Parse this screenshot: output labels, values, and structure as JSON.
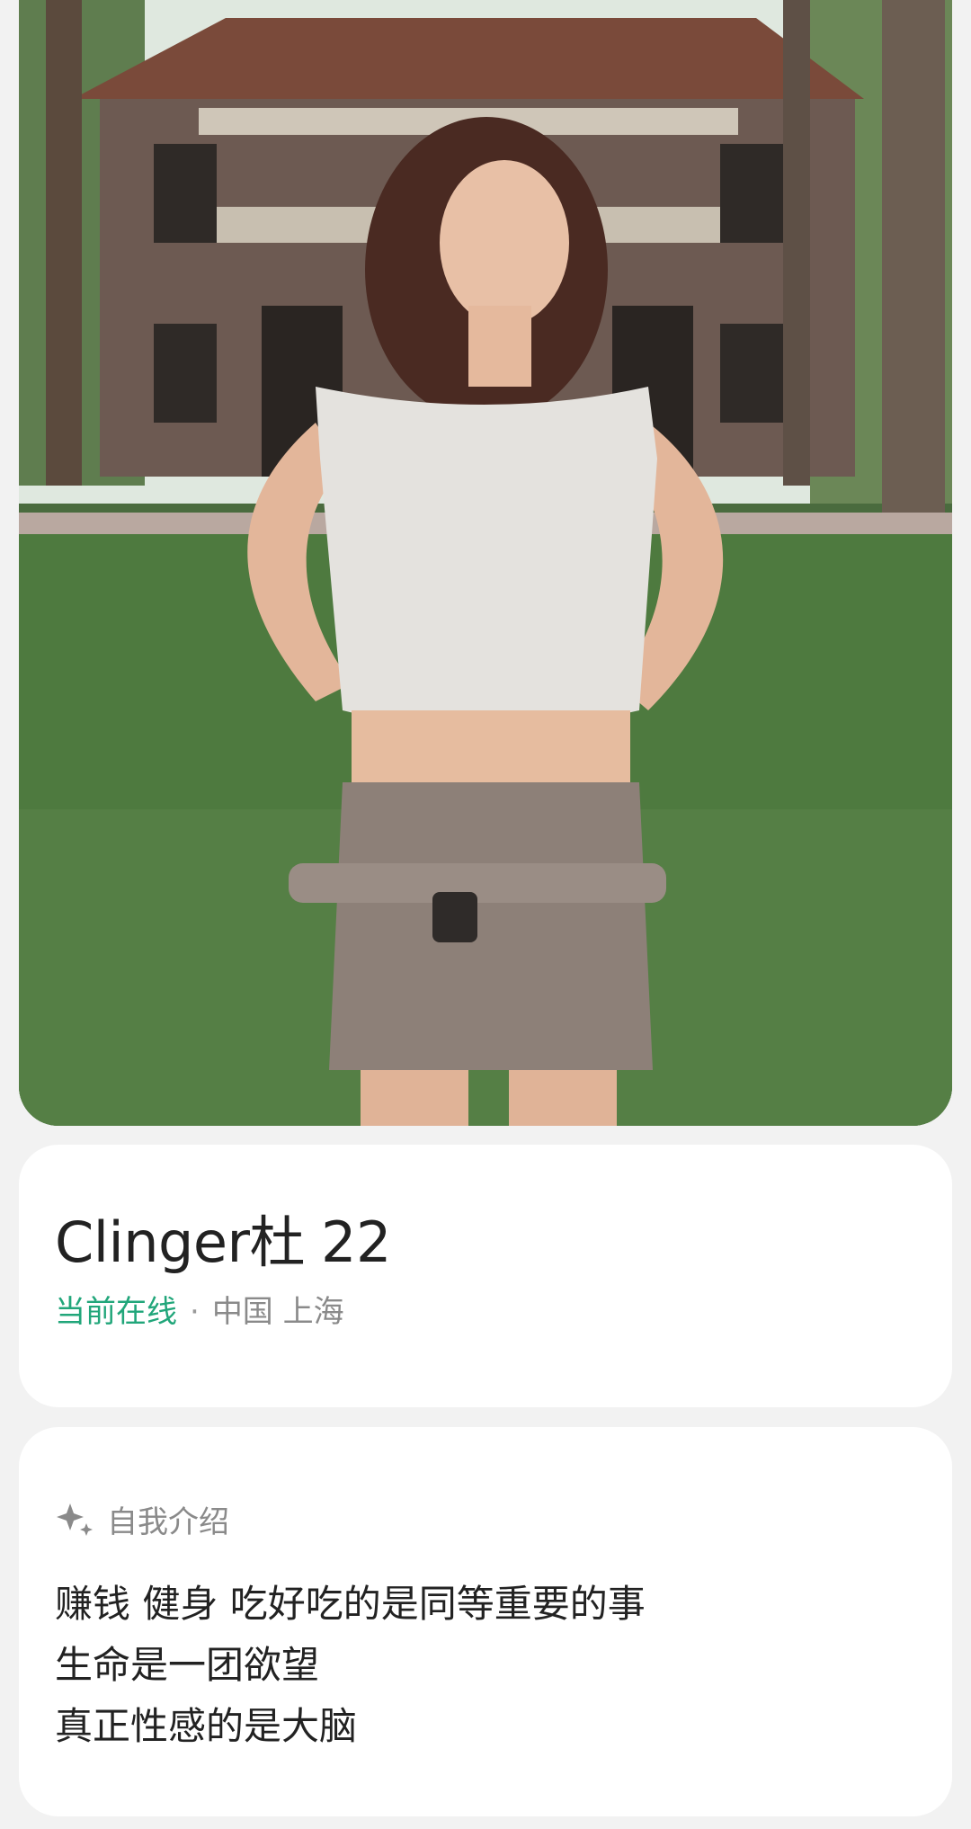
{
  "profile": {
    "name": "Clinger杜",
    "age": "22",
    "status": "当前在线",
    "separator": "·",
    "location": "中国 上海",
    "photo_icon": "profile-photo"
  },
  "bio": {
    "title": "自我介绍",
    "icon": "sparkle-icon",
    "lines": [
      "赚钱 健身 吃好吃的是同等重要的事",
      "生命是一团欲望",
      "真正性感的是大脑"
    ]
  },
  "colors": {
    "online": "#21a67a",
    "muted": "#8a8a8a",
    "background": "#f2f2f2"
  }
}
